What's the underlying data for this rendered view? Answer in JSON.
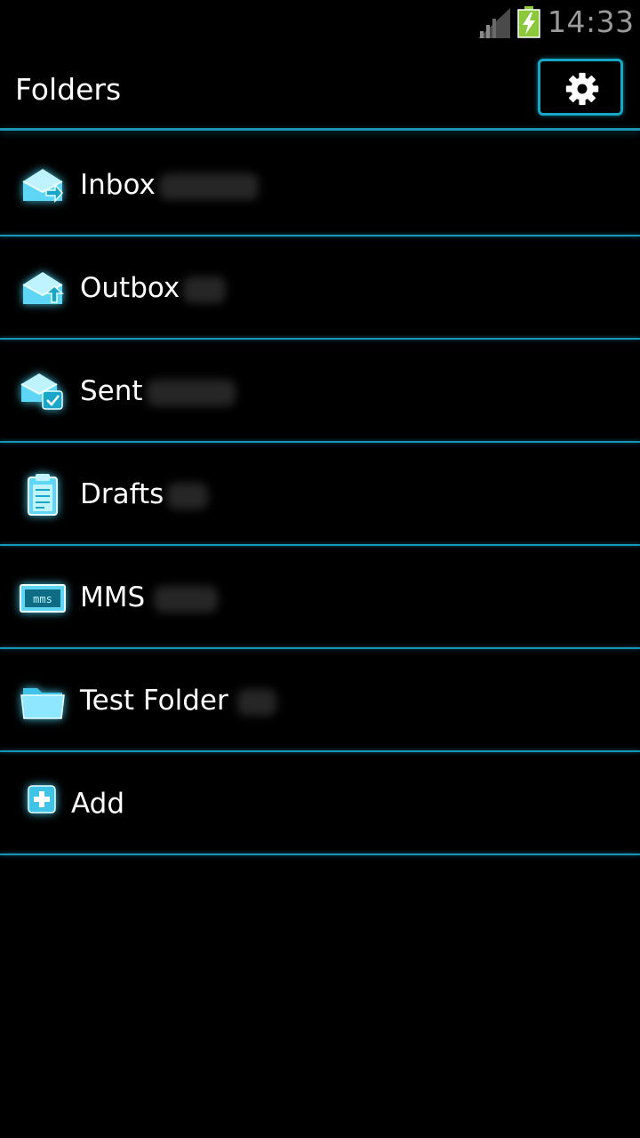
{
  "status_bar": {
    "time": "14:33",
    "signal_icon": "signal-icon",
    "battery_icon": "battery-charging-icon",
    "battery_color": "#8cc83c"
  },
  "header": {
    "title": "Folders",
    "settings_icon": "gear-icon"
  },
  "colors": {
    "accent": "#1aa6c8",
    "glow": "#5cdcff",
    "background": "#000000",
    "text": "#ffffff",
    "clock": "#9a9a9a"
  },
  "folders": [
    {
      "label": "Inbox",
      "icon": "inbox-icon"
    },
    {
      "label": "Outbox",
      "icon": "outbox-icon"
    },
    {
      "label": "Sent",
      "icon": "sent-icon"
    },
    {
      "label": "Drafts",
      "icon": "drafts-icon"
    },
    {
      "label": "MMS",
      "icon": "mms-icon",
      "icon_text": "mms"
    },
    {
      "label": "Test Folder",
      "icon": "folder-icon"
    }
  ],
  "add_item": {
    "label": "Add",
    "icon": "add-icon"
  }
}
